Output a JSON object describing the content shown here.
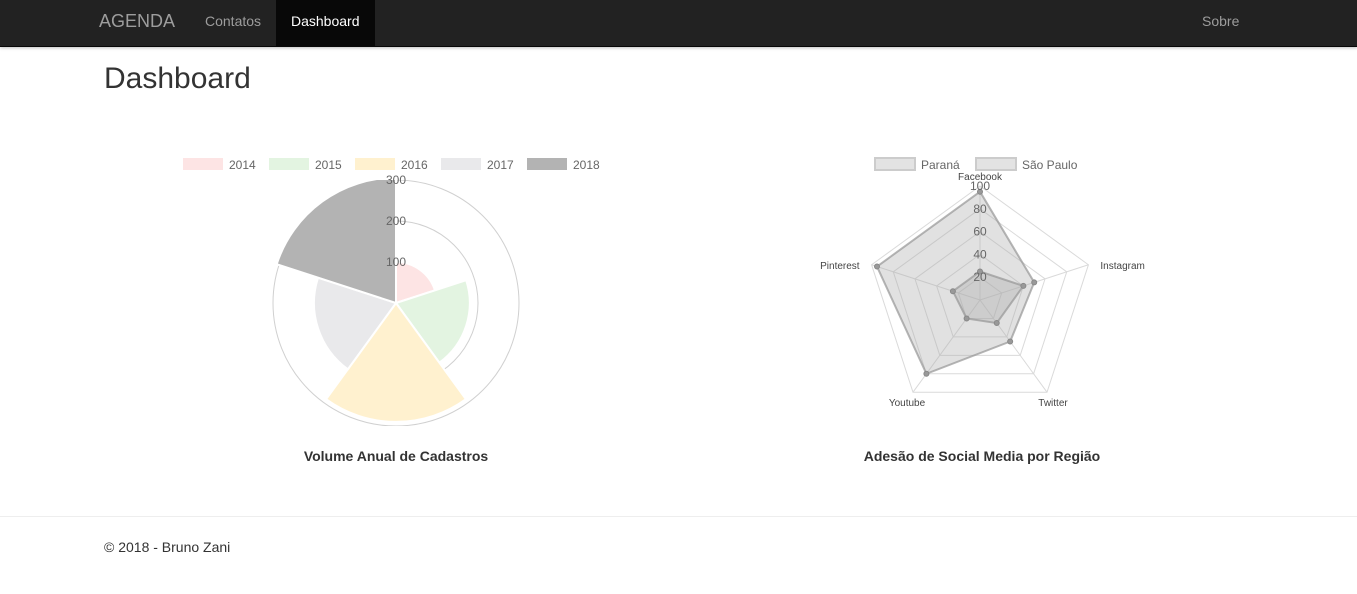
{
  "navbar": {
    "brand": "AGENDA",
    "links": [
      {
        "label": "Contatos",
        "active": false
      },
      {
        "label": "Dashboard",
        "active": true
      }
    ],
    "right_link": "Sobre"
  },
  "page": {
    "title": "Dashboard"
  },
  "colors": {
    "navbar_bg": "#222222",
    "active_bg": "#080808",
    "series_2014": "#fde4e4",
    "series_2015": "#e3f4e1",
    "series_2016": "#fff1cf",
    "series_2017": "#e9e9eb",
    "series_2018": "#b3b3b3"
  },
  "chart_data": [
    {
      "type": "polarArea",
      "title": "Volume Anual de Cadastros",
      "categories": [
        "2014",
        "2015",
        "2016",
        "2017",
        "2018"
      ],
      "values": [
        100,
        180,
        290,
        200,
        310
      ],
      "colors": [
        "#fde4e4",
        "#e3f4e1",
        "#fff1cf",
        "#e9e9eb",
        "#b3b3b3"
      ],
      "r_ticks": [
        "100",
        "200",
        "300"
      ],
      "r_max": 300,
      "legend_position": "top"
    },
    {
      "type": "radar",
      "title": "Adesão de Social Media por Região",
      "categories": [
        "Facebook",
        "Instagram",
        "Twitter",
        "Youtube",
        "Pinterest"
      ],
      "series": [
        {
          "name": "Paraná",
          "values": [
            95,
            50,
            45,
            80,
            95
          ]
        },
        {
          "name": "São Paulo",
          "values": [
            25,
            40,
            25,
            20,
            25
          ]
        }
      ],
      "r_ticks": [
        "20",
        "40",
        "60",
        "80",
        "100"
      ],
      "r_max": 100,
      "legend_position": "top"
    }
  ],
  "footer": {
    "text": "© 2018 - Bruno Zani"
  }
}
